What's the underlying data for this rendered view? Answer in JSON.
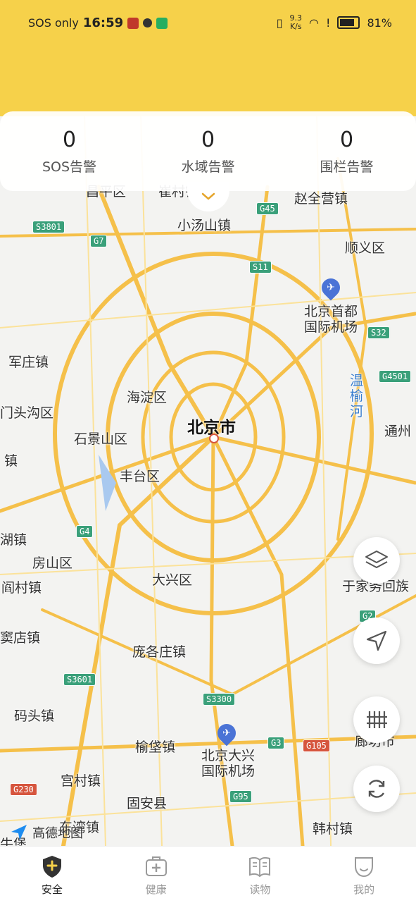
{
  "status_bar": {
    "carrier": "SOS only",
    "time": "16:59",
    "net_speed_top": "9.3",
    "net_speed_bottom": "K/s",
    "battery": "81%"
  },
  "stats": [
    {
      "value": "0",
      "label": "SOS告警"
    },
    {
      "value": "0",
      "label": "水域告警"
    },
    {
      "value": "0",
      "label": "围栏告警"
    }
  ],
  "map": {
    "city": "北京市",
    "provider": "高德地图",
    "places": [
      "昌平区",
      "崔村镇",
      "赵全营镇",
      "小汤山镇",
      "顺义区",
      "北京首都",
      "国际机场",
      "军庄镇",
      "海淀区",
      "温",
      "榆",
      "河",
      "通州",
      "门头沟区",
      "石景山区",
      "丰台区",
      "镇",
      "湖镇",
      "房山区",
      "阎村镇",
      "大兴区",
      "于家务回族",
      "窦店镇",
      "庞各庄镇",
      "码头镇",
      "榆垡镇",
      "北京大兴",
      "国际机场",
      "廊坊市",
      "宫村镇",
      "固安县",
      "东湾镇",
      "韩村镇",
      "牛堡"
    ],
    "roads": [
      "S3801",
      "G7",
      "G45",
      "S11",
      "S32",
      "G4501",
      "G4",
      "G2",
      "S3601",
      "S3300",
      "G3",
      "G105",
      "G230",
      "G95"
    ]
  },
  "tabs": [
    {
      "label": "安全",
      "icon": "shield-plus-icon",
      "active": true
    },
    {
      "label": "健康",
      "icon": "medical-kit-icon",
      "active": false
    },
    {
      "label": "读物",
      "icon": "book-icon",
      "active": false
    },
    {
      "label": "我的",
      "icon": "profile-icon",
      "active": false
    }
  ],
  "colors": {
    "accent": "#f6d14a",
    "road": "#f5c04a",
    "icon": "#5a5a5a"
  }
}
